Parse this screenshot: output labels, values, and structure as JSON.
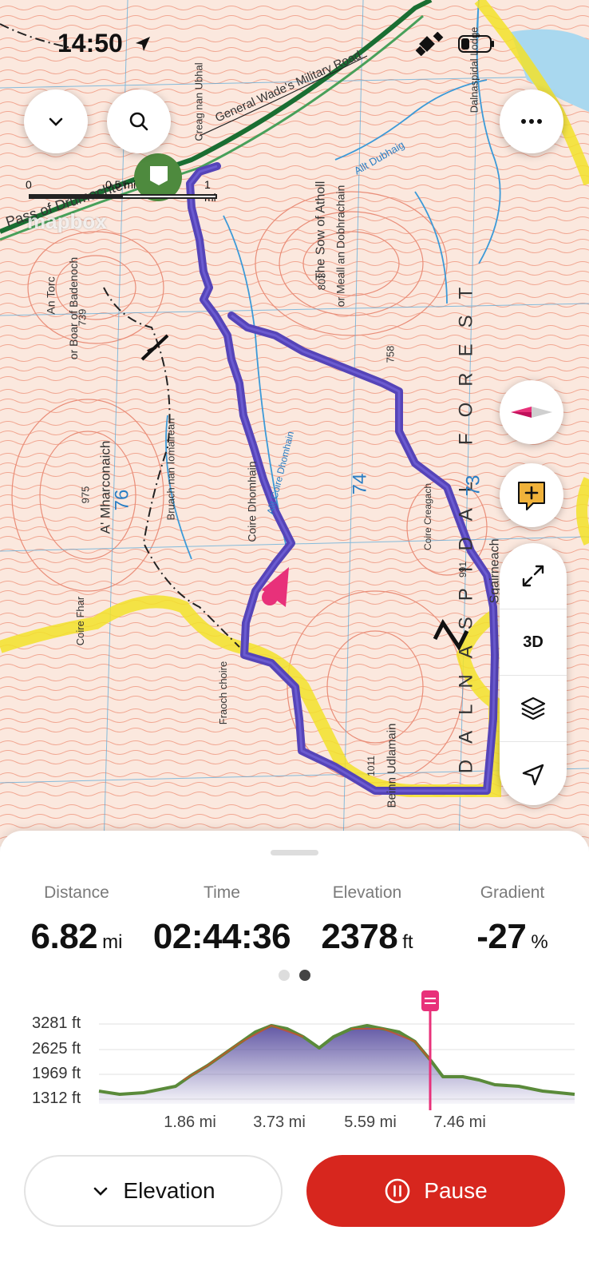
{
  "status_bar": {
    "time": "14:50",
    "location_icon": "location-arrow-icon"
  },
  "map": {
    "scale": {
      "zero": "0",
      "half": "0.5 mi",
      "full": "1 mi"
    },
    "attribution": "mapbox",
    "labels": {
      "pass": "Pass of Drumochter",
      "road": "General Wade's Military Road",
      "creag": "Creag nan Ubhal",
      "dalnaspidal_lodge": "Dalnaspidal Lodge",
      "allt_dubhaig": "Allt Dubhaig",
      "sow": "The Sow of Atholl",
      "sow_alt": "or Meall an Dobhrachain",
      "sow_height": "803",
      "an_torc": "An Torc",
      "boar": "or Boar of Badenoch",
      "boar_height": "739",
      "forest": "DALNASPIDAL FOREST",
      "height_758": "758",
      "a_mharconaich": "A' Mharconaich",
      "height_975": "975",
      "bruach": "Bruach nan Iomairean",
      "coire_dhomhain": "Coire Dhomhain",
      "allt_coire_dhomhain": "Allt Coire Dhomhain",
      "coire_creagach": "Coire Creagach",
      "height_991": "991",
      "sgairneach": "Sgairneach",
      "coire_fhar": "Coire Fhar",
      "fraoch": "Fraoch choire",
      "beinn_udlamain": "Beinn Udlamain",
      "height_1011": "1011",
      "grid_76": "76",
      "grid_74": "74",
      "grid_73": "73",
      "route_color": "#5544b8",
      "highlight_color": "#f2e22a"
    }
  },
  "stats": [
    {
      "label": "Distance",
      "value": "6.82",
      "unit": "mi"
    },
    {
      "label": "Time",
      "value": "02:44:36",
      "unit": ""
    },
    {
      "label": "Elevation",
      "value": "2378",
      "unit": "ft"
    },
    {
      "label": "Gradient",
      "value": "-27",
      "unit": "%"
    }
  ],
  "pager": {
    "count": 2,
    "active": 1
  },
  "profile": {
    "y_labels": [
      "3281 ft",
      "2625 ft",
      "1969 ft",
      "1312 ft"
    ],
    "x_labels": [
      "1.86 mi",
      "3.73 mi",
      "5.59 mi",
      "7.46 mi"
    ],
    "current_position_mi": 7.46
  },
  "buttons": {
    "elevation_label": "Elevation",
    "pause_label": "Pause"
  },
  "colors": {
    "accent_red": "#d7261e",
    "marker_pink": "#e8317a"
  }
}
